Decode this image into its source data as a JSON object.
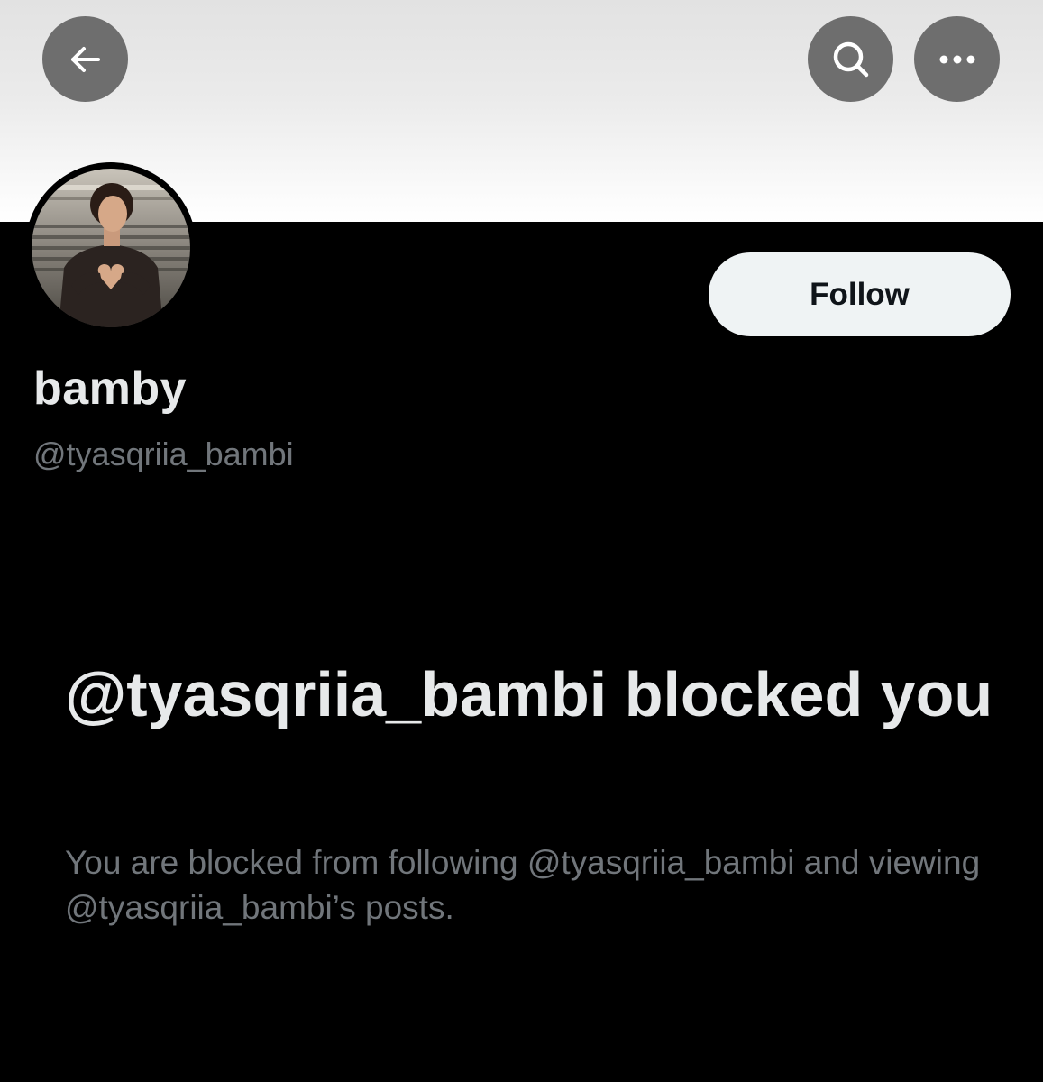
{
  "header": {
    "back_icon": "arrow-left-icon",
    "search_icon": "search-icon",
    "more_icon": "more-horizontal-icon",
    "banner_color": "#ebebeb",
    "button_color": "#6e6e6e"
  },
  "profile": {
    "avatar_icon": "profile-avatar",
    "display_name": "bamby",
    "handle": "@tyasqriia_bambi",
    "follow_label": "Follow"
  },
  "blocked_notice": {
    "title": "@tyasqriia_bambi blocked you",
    "description": "You are blocked from following @tyasqriia_bambi and viewing @tyasqriia_bambi’s posts."
  },
  "colors": {
    "background": "#000000",
    "primary_text": "#e7e9ea",
    "secondary_text": "#71767b",
    "follow_button_bg": "#eff3f4",
    "follow_button_text": "#0f1419"
  }
}
